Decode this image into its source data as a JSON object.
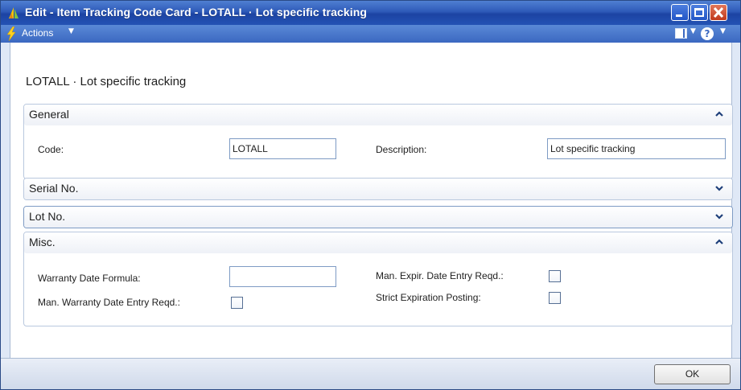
{
  "window": {
    "title": "Edit - Item Tracking Code Card - LOTALL · Lot specific tracking"
  },
  "actionbar": {
    "actions_label": "Actions"
  },
  "page": {
    "title": "LOTALL · Lot specific tracking"
  },
  "general": {
    "header": "General",
    "code_label": "Code:",
    "code_value": "LOTALL",
    "description_label": "Description:",
    "description_value": "Lot specific tracking"
  },
  "serial": {
    "header": "Serial No."
  },
  "lot": {
    "header": "Lot No."
  },
  "misc": {
    "header": "Misc.",
    "warranty_date_formula_label": "Warranty Date Formula:",
    "warranty_date_formula_value": "",
    "man_warranty_label": "Man. Warranty Date Entry Reqd.:",
    "man_warranty_checked": false,
    "man_expir_label": "Man. Expir. Date Entry Reqd.:",
    "man_expir_checked": false,
    "strict_expiration_label": "Strict Expiration Posting:",
    "strict_expiration_checked": false
  },
  "footer": {
    "ok_label": "OK"
  },
  "colors": {
    "titlebar": "#2e5ab8",
    "actionbar": "#3b68c1",
    "close_button": "#c0391c",
    "window_background": "#dfe8f6"
  },
  "icons": {
    "app": "dynamics-nav-icon",
    "actions": "lightning-icon",
    "layout": "layout-icon",
    "help": "help-icon",
    "collapse": "chevron-up-icon",
    "expand": "chevron-down-icon"
  }
}
